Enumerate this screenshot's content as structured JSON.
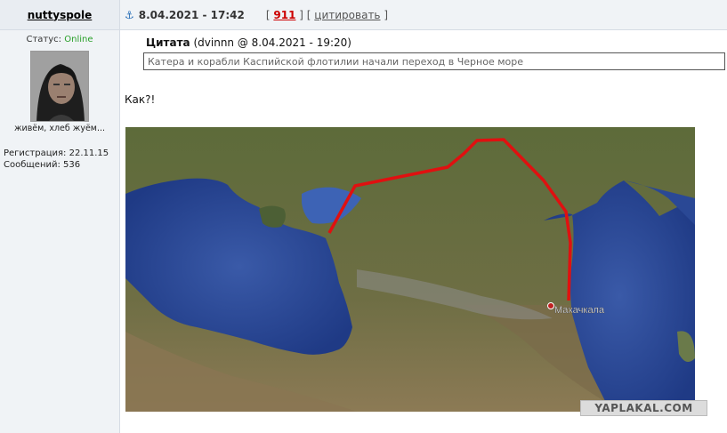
{
  "post": {
    "author": "nuttyspole",
    "date": "8.04.2021 - 17:42",
    "rating": "911",
    "quote_action": "цитировать",
    "bracket_open": "[",
    "bracket_mid": "] [",
    "bracket_close": "]"
  },
  "user": {
    "status_label": "Статус:",
    "status_value": "Online",
    "signature": "живём, хлеб жуём...",
    "registration": "Регистрация: 22.11.15",
    "messages": "Сообщений: 536"
  },
  "quote": {
    "label": "Цитата",
    "source": "(dvinnn @ 8.04.2021 - 19:20)",
    "text": "Катера и корабли Каспийской флотилии начали переход в Черное море"
  },
  "body_text": "Как?!",
  "map": {
    "city_label": "Махачкала",
    "route_color": "#e01010"
  },
  "watermark": "YAPLAKAL.COM"
}
